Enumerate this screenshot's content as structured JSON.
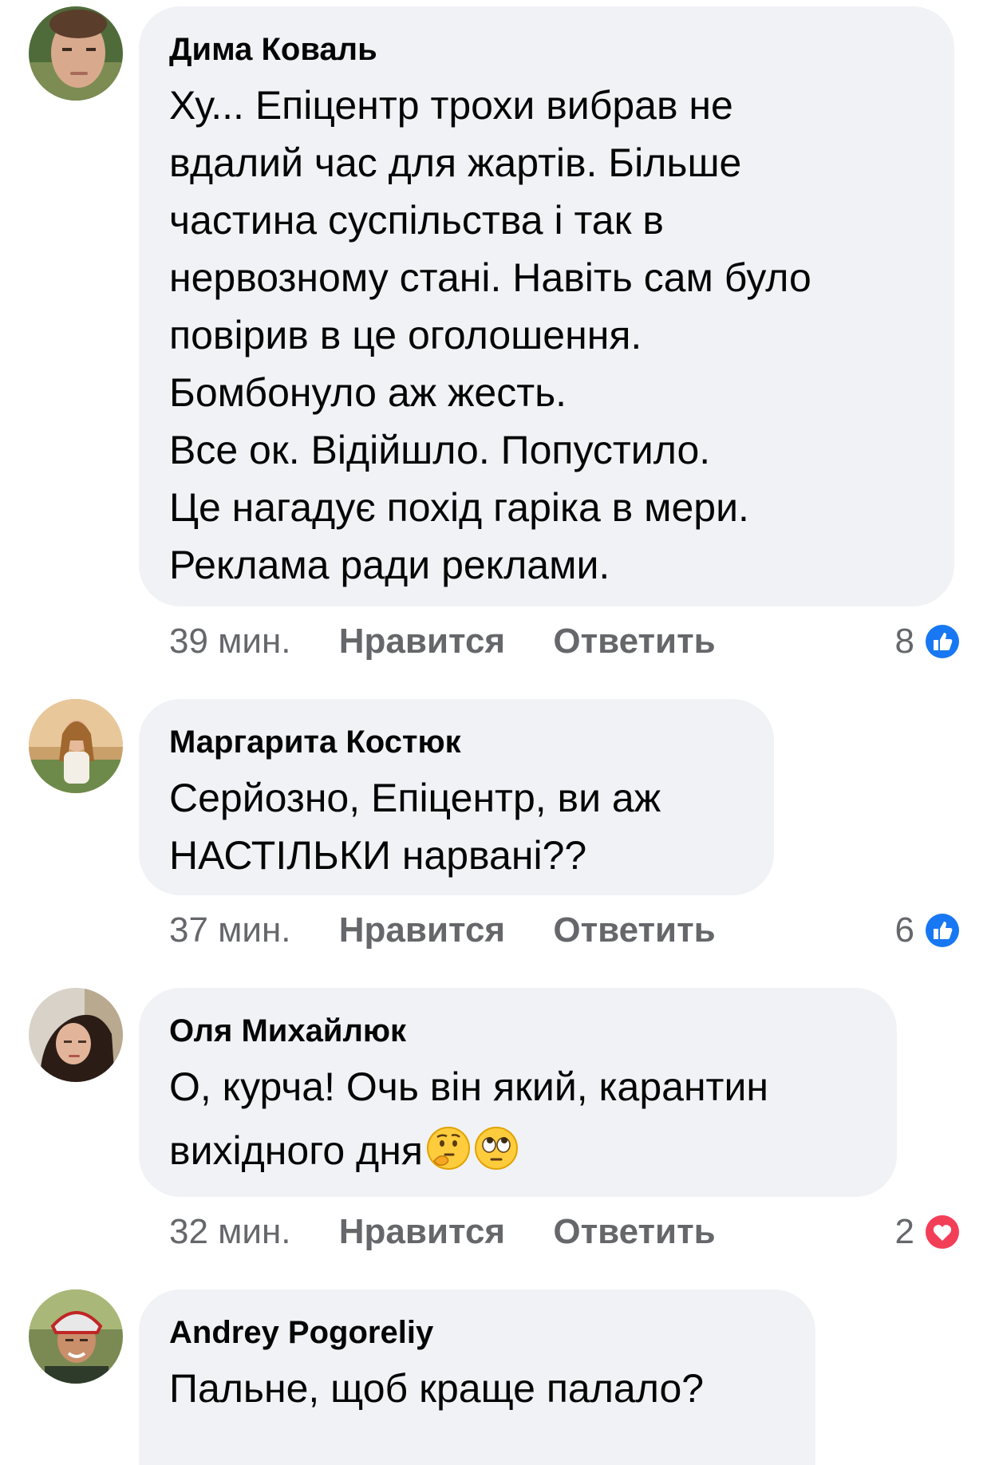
{
  "comments": [
    {
      "author": "Дима Коваль",
      "lines": [
        "Ху... Епіцентр трохи вибрав не",
        "вдалий час для жартів. Більше",
        "частина суспільства і так в",
        "нервозному стані. Навіть сам було",
        "повірив в це оголошення.",
        "Бомбонуло аж жесть.",
        "Все ок. Відійшло. Попустило.",
        "Це нагадує похід гаріка в мери.",
        "Реклама ради реклами."
      ],
      "time": "39 мин.",
      "like_label": "Нравится",
      "reply_label": "Ответить",
      "reaction_count": "8",
      "reaction_icon": "like-icon",
      "avatar_icon": "avatar-photo-icon"
    },
    {
      "author": "Маргарита Костюк",
      "lines": [
        "Серйозно, Епіцентр, ви аж",
        "НАСТІЛЬКИ нарвані??"
      ],
      "time": "37 мин.",
      "like_label": "Нравится",
      "reply_label": "Ответить",
      "reaction_count": "6",
      "reaction_icon": "like-icon",
      "avatar_icon": "avatar-photo-icon"
    },
    {
      "author": "Оля Михайлюк",
      "lines": [
        "О, курча! Очь він який, карантин",
        "вихідного дня"
      ],
      "emojis": [
        "thinking-face-icon",
        "eye-roll-face-icon"
      ],
      "time": "32 мин.",
      "like_label": "Нравится",
      "reply_label": "Ответить",
      "reaction_count": "2",
      "reaction_icon": "love-icon",
      "avatar_icon": "avatar-photo-icon"
    },
    {
      "author": "Andrey Pogoreliy",
      "lines": [
        "Пальне, щоб краще палало?"
      ],
      "avatar_icon": "avatar-photo-icon"
    }
  ],
  "colors": {
    "bubble_bg": "#f0f2f5",
    "meta_text": "#65676b",
    "like_blue": "#1877f2",
    "love_red": "#f33e58"
  }
}
